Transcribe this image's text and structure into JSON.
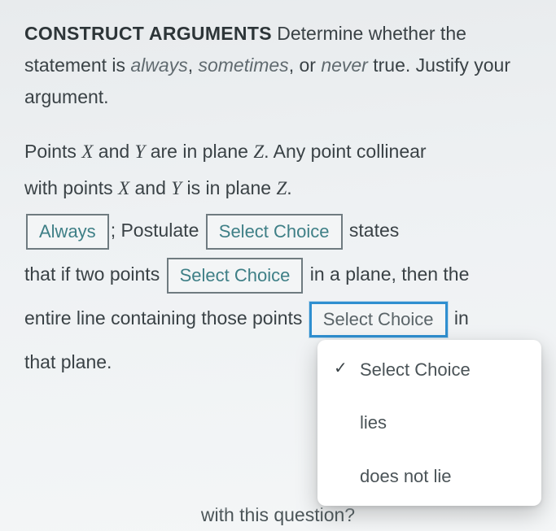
{
  "prompt": {
    "heading": "CONSTRUCT ARGUMENTS",
    "instruction_pre": " Determine whether the statement is ",
    "word_always": "always",
    "sep1": ", ",
    "word_sometimes": "sometimes",
    "sep2": ", or ",
    "word_never": "never",
    "instruction_post": " true. Justify your argument."
  },
  "question": {
    "line1_a": "Points ",
    "var_X": "X",
    "line1_b": " and ",
    "var_Y": "Y",
    "line1_c": " are in plane ",
    "var_Z": "Z",
    "line1_d": ". Any point collinear",
    "line2_a": "with points ",
    "line2_b": " and ",
    "line2_c": " is in plane ",
    "line2_d": "."
  },
  "fill": {
    "select1_value": "Always",
    "after1": "; Postulate ",
    "select2_label": "Select Choice",
    "after2": " states",
    "line3_a": "that if two points ",
    "select3_label": "Select Choice",
    "line3_b": " in a plane, then the",
    "line4_a": "entire line containing those points ",
    "select4_label": "Select Choice",
    "line4_b": " in",
    "line5": "that plane."
  },
  "dropdown": {
    "opt_placeholder": "Select Choice",
    "opt_lies": "lies",
    "opt_doesnotlie": "does not lie"
  },
  "footer": "with this question?"
}
